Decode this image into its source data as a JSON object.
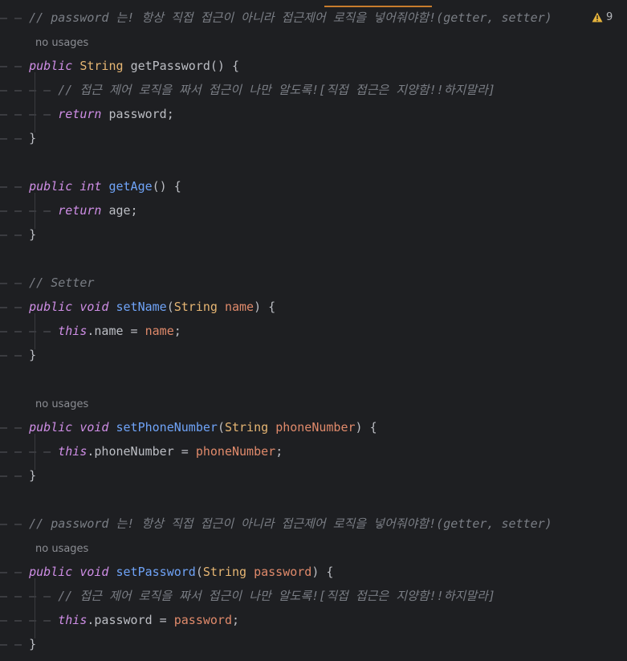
{
  "editor": {
    "warning_count": "9",
    "no_usages": "no usages",
    "lines": [
      {
        "indent": 1,
        "parts": [
          [
            "cm",
            "// password 는! 항상 직접 접근이 아니라 접근제어 로직을 넣어줘야함!(getter, setter)"
          ]
        ]
      },
      {
        "indent": 1,
        "parts": [
          [
            "kw",
            "public"
          ],
          [
            "br",
            " "
          ],
          [
            "typ",
            "String"
          ],
          [
            "br",
            " "
          ],
          [
            "br",
            "getPassword() {"
          ]
        ]
      },
      {
        "indent": 2,
        "parts": [
          [
            "cm",
            "// 접근 제어 로직을 짜서 접근이 나만 알도록![직접 접근은 지양함!!하지말라]"
          ]
        ]
      },
      {
        "indent": 2,
        "parts": [
          [
            "kw",
            "return"
          ],
          [
            "br",
            " password;"
          ]
        ]
      },
      {
        "indent": 1,
        "parts": [
          [
            "br",
            "}"
          ]
        ]
      },
      {
        "indent": 1,
        "parts": [
          [
            "kw",
            "public"
          ],
          [
            "br",
            " "
          ],
          [
            "kw",
            "int"
          ],
          [
            "br",
            " "
          ],
          [
            "fn",
            "getAge"
          ],
          [
            "br",
            "() {"
          ]
        ]
      },
      {
        "indent": 2,
        "parts": [
          [
            "kw",
            "return"
          ],
          [
            "br",
            " age;"
          ]
        ]
      },
      {
        "indent": 1,
        "parts": [
          [
            "br",
            "}"
          ]
        ]
      },
      {
        "indent": 1,
        "parts": [
          [
            "cm",
            "// Setter"
          ]
        ]
      },
      {
        "indent": 1,
        "parts": [
          [
            "kw",
            "public"
          ],
          [
            "br",
            " "
          ],
          [
            "kw",
            "void"
          ],
          [
            "br",
            " "
          ],
          [
            "fn",
            "setName"
          ],
          [
            "br",
            "("
          ],
          [
            "typ",
            "String"
          ],
          [
            "br",
            " "
          ],
          [
            "pm",
            "name"
          ],
          [
            "br",
            ") {"
          ]
        ]
      },
      {
        "indent": 2,
        "parts": [
          [
            "kw",
            "this"
          ],
          [
            "br",
            ".name = "
          ],
          [
            "pm",
            "name"
          ],
          [
            "br",
            ";"
          ]
        ]
      },
      {
        "indent": 1,
        "parts": [
          [
            "br",
            "}"
          ]
        ]
      },
      {
        "indent": 1,
        "parts": [
          [
            "kw",
            "public"
          ],
          [
            "br",
            " "
          ],
          [
            "kw",
            "void"
          ],
          [
            "br",
            " "
          ],
          [
            "fn",
            "setPhoneNumber"
          ],
          [
            "br",
            "("
          ],
          [
            "typ",
            "String"
          ],
          [
            "br",
            " "
          ],
          [
            "pm",
            "phoneNumber"
          ],
          [
            "br",
            ") {"
          ]
        ]
      },
      {
        "indent": 2,
        "parts": [
          [
            "kw",
            "this"
          ],
          [
            "br",
            ".phoneNumber = "
          ],
          [
            "pm",
            "phoneNumber"
          ],
          [
            "br",
            ";"
          ]
        ]
      },
      {
        "indent": 1,
        "parts": [
          [
            "br",
            "}"
          ]
        ]
      },
      {
        "indent": 1,
        "parts": [
          [
            "cm",
            "// password 는! 항상 직접 접근이 아니라 접근제어 로직을 넣어줘야함!(getter, setter)"
          ]
        ]
      },
      {
        "indent": 1,
        "parts": [
          [
            "kw",
            "public"
          ],
          [
            "br",
            " "
          ],
          [
            "kw",
            "void"
          ],
          [
            "br",
            " "
          ],
          [
            "fn",
            "setPassword"
          ],
          [
            "br",
            "("
          ],
          [
            "typ",
            "String"
          ],
          [
            "br",
            " "
          ],
          [
            "pm",
            "password"
          ],
          [
            "br",
            ") {"
          ]
        ]
      },
      {
        "indent": 2,
        "parts": [
          [
            "cm",
            "// 접근 제어 로직을 짜서 접근이 나만 알도록![직접 접근은 지양함!!하지말라]"
          ]
        ]
      },
      {
        "indent": 2,
        "parts": [
          [
            "kw",
            "this"
          ],
          [
            "br",
            ".password = "
          ],
          [
            "pm",
            "password"
          ],
          [
            "br",
            ";"
          ]
        ]
      },
      {
        "indent": 1,
        "parts": [
          [
            "br",
            "}"
          ]
        ]
      }
    ]
  },
  "colors": {
    "background": "#1e1f22",
    "keyword": "#cf8ee6",
    "type": "#e6b673",
    "function": "#6fa3f7",
    "parameter": "#e08a6b",
    "comment": "#7a7e85",
    "warning": "#e5b33c"
  },
  "icons": {
    "warning": "warning-triangle-icon"
  }
}
